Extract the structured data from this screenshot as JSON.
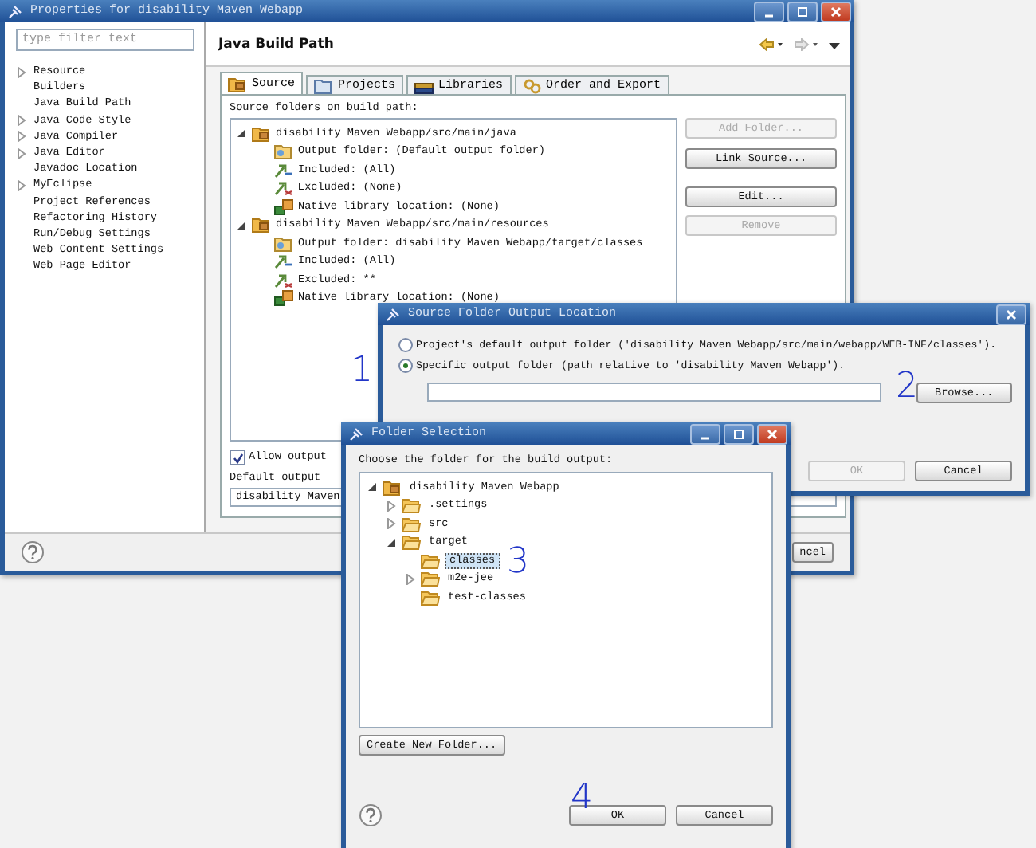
{
  "main_window": {
    "title": "Properties for disability Maven Webapp",
    "filter": {
      "placeholder": "type filter text"
    },
    "nav": [
      {
        "label": "Resource",
        "expandable": true
      },
      {
        "label": "Builders",
        "expandable": false
      },
      {
        "label": "Java Build Path",
        "expandable": false
      },
      {
        "label": "Java Code Style",
        "expandable": true
      },
      {
        "label": "Java Compiler",
        "expandable": true
      },
      {
        "label": "Java Editor",
        "expandable": true
      },
      {
        "label": "Javadoc Location",
        "expandable": false
      },
      {
        "label": "MyEclipse",
        "expandable": true
      },
      {
        "label": "Project References",
        "expandable": false
      },
      {
        "label": "Refactoring History",
        "expandable": false
      },
      {
        "label": "Run/Debug Settings",
        "expandable": false
      },
      {
        "label": "Web Content Settings",
        "expandable": false
      },
      {
        "label": "Web Page Editor",
        "expandable": false
      }
    ],
    "page_title": "Java Build Path",
    "tabs": [
      {
        "label": "Source",
        "kind": "source",
        "selected": true
      },
      {
        "label": "Projects",
        "kind": "projects",
        "selected": false
      },
      {
        "label": "Libraries",
        "kind": "libraries",
        "selected": false
      },
      {
        "label": "Order and Export",
        "kind": "order",
        "selected": false
      }
    ],
    "source_label": "Source folders on build path:",
    "source_tree": [
      {
        "label": "disability Maven Webapp/src/main/java",
        "expanded": true,
        "children": [
          {
            "kind": "output",
            "label": "Output folder: (Default output folder)"
          },
          {
            "kind": "included",
            "label": "Included: (All)"
          },
          {
            "kind": "excluded",
            "label": "Excluded: (None)"
          },
          {
            "kind": "native",
            "label": "Native library location: (None)"
          }
        ]
      },
      {
        "label": "disability Maven Webapp/src/main/resources",
        "expanded": true,
        "children": [
          {
            "kind": "output",
            "label": "Output folder: disability Maven Webapp/target/classes"
          },
          {
            "kind": "included",
            "label": "Included: (All)"
          },
          {
            "kind": "excluded",
            "label": "Excluded: **"
          },
          {
            "kind": "native",
            "label": "Native library location: (None)"
          }
        ]
      }
    ],
    "side_buttons": [
      {
        "label": "Add Folder...",
        "disabled": true
      },
      {
        "label": "Link Source...",
        "disabled": false
      },
      {
        "label": "Edit...",
        "disabled": false
      },
      {
        "label": "Remove",
        "disabled": true
      }
    ],
    "allow_output": {
      "label": "Allow output",
      "checked": true
    },
    "default_output_label": "Default output",
    "default_output_value": "disability Maven",
    "bottom_button": "ncel"
  },
  "output_dialog": {
    "title": "Source Folder Output Location",
    "options": [
      {
        "label": "Project's default output folder ('disability Maven Webapp/src/main/webapp/WEB-INF/classes').",
        "selected": false
      },
      {
        "label": "Specific output folder (path relative to 'disability Maven Webapp').",
        "selected": true
      }
    ],
    "browse": "Browse...",
    "buttons": [
      {
        "label": "OK",
        "disabled": true
      },
      {
        "label": "Cancel",
        "disabled": false
      }
    ]
  },
  "folder_dialog": {
    "title": "Folder Selection",
    "prompt": "Choose the folder for the build output:",
    "tree": [
      {
        "label": "disability Maven Webapp",
        "kind": "project",
        "expanded": true,
        "selected": false,
        "children": [
          {
            "label": ".settings",
            "kind": "folder",
            "expanded": false,
            "selected": false
          },
          {
            "label": "src",
            "kind": "folder",
            "expanded": false,
            "selected": false
          },
          {
            "label": "target",
            "kind": "folder",
            "expanded": true,
            "selected": false,
            "children": [
              {
                "label": "classes",
                "kind": "folder",
                "selected": true
              },
              {
                "label": "m2e-jee",
                "kind": "folder",
                "expanded": false,
                "selected": false
              },
              {
                "label": "test-classes",
                "kind": "folder",
                "selected": false
              }
            ]
          }
        ]
      }
    ],
    "create_button": "Create New Folder...",
    "buttons": [
      {
        "label": "OK",
        "disabled": false
      },
      {
        "label": "Cancel",
        "disabled": false
      }
    ]
  },
  "annotations": [
    "1",
    "2",
    "3",
    "4"
  ]
}
